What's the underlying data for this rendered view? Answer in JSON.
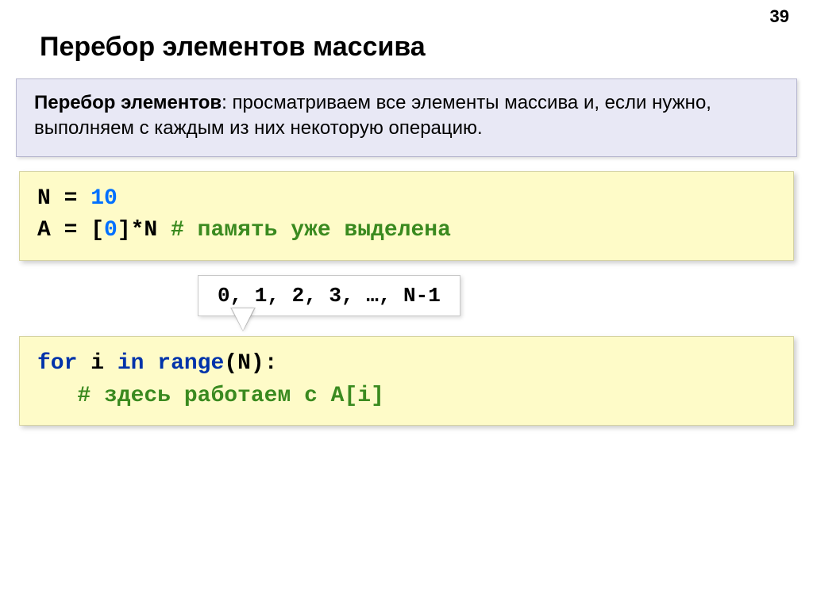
{
  "page_number": "39",
  "title": "Перебор элементов массива",
  "definition": {
    "term": "Перебор элементов",
    "body": ": просматриваем все элементы массива и, если нужно, выполняем с каждым из них некоторую операцию."
  },
  "code1": {
    "line1_a": "N = ",
    "line1_b": "10",
    "line2_a": "A = [",
    "line2_b": "0",
    "line2_c": "]*N   ",
    "line2_comment": "# память уже выделена"
  },
  "callout_text": "0, 1, 2, 3, …, N-1",
  "code2": {
    "line1_for": "for",
    "line1_mid": " i ",
    "line1_in": "in",
    "line1_range_sp": " ",
    "line1_range": "range",
    "line1_end": "(N):",
    "line2_indent": "   ",
    "line2_comment": "# здесь работаем с A[i]"
  }
}
